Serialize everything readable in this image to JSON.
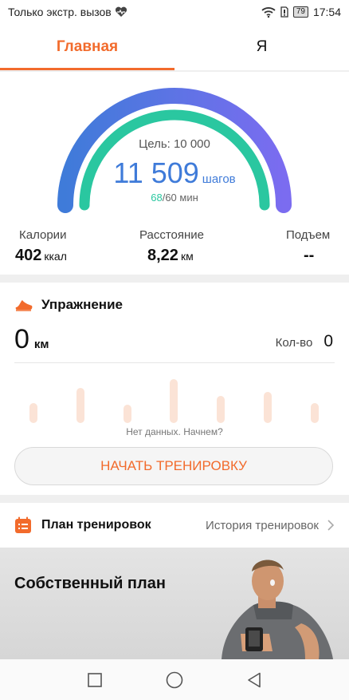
{
  "status_bar": {
    "carrier_text": "Только экстр. вызов",
    "battery": "79",
    "time": "17:54",
    "icons": [
      "heart-pulse-icon",
      "wifi-icon",
      "sim-icon",
      "battery-icon"
    ]
  },
  "tabs": [
    {
      "label": "Главная",
      "active": true
    },
    {
      "label": "Я",
      "active": false
    }
  ],
  "gauge": {
    "goal_label": "Цель: 10 000",
    "steps": "11 509",
    "steps_unit": "шагов",
    "active_minutes": "68",
    "minutes_goal": "/60 мин",
    "outer_progress": 1.0,
    "inner_progress": 1.0
  },
  "stats": [
    {
      "label": "Калории",
      "value": "402",
      "unit": "ккал"
    },
    {
      "label": "Расстояние",
      "value": "8,22",
      "unit": "км"
    },
    {
      "label": "Подъем",
      "value": "--",
      "unit": ""
    }
  ],
  "exercise": {
    "title": "Упражнение",
    "distance_value": "0",
    "distance_unit": "км",
    "count_label": "Кол-во",
    "count_value": "0",
    "placeholder_bars": [
      0.45,
      0.8,
      0.42,
      1.0,
      0.62,
      0.7,
      0.45,
      0.62
    ],
    "no_data_text": "Нет данных. Начнем?",
    "start_button": "НАЧАТЬ ТРЕНИРОВКУ"
  },
  "plan": {
    "title": "План тренировок",
    "history_link": "История тренировок"
  },
  "banner": {
    "title": "Собственный план"
  },
  "colors": {
    "accent": "#f26b2c",
    "steps_blue": "#3f7bd9",
    "gauge_outer_start": "#3f7bd9",
    "gauge_outer_end": "#7b6cf0",
    "gauge_inner": "#2ac7a0"
  },
  "nav_bar": {
    "icons": [
      "recent-apps-icon",
      "home-icon",
      "back-icon"
    ]
  }
}
